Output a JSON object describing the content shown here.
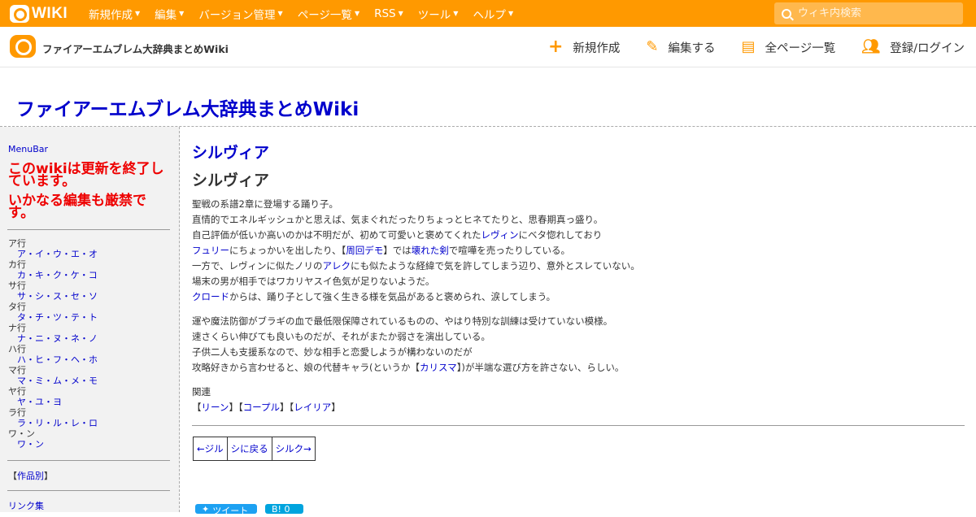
{
  "topbar": {
    "logo_text": "WIKI",
    "menu": [
      {
        "label": "新規作成"
      },
      {
        "label": "編集"
      },
      {
        "label": "バージョン管理"
      },
      {
        "label": "ページ一覧"
      },
      {
        "label": "RSS"
      },
      {
        "label": "ツール"
      },
      {
        "label": "ヘルプ"
      }
    ],
    "search_placeholder": "ウィキ内検索"
  },
  "header": {
    "site_name": "ファイアーエムブレム大辞典まとめWiki",
    "actions": [
      {
        "label": "新規作成",
        "icon": "plus-icon"
      },
      {
        "label": "編集する",
        "icon": "pencil-icon"
      },
      {
        "label": "全ページ一覧",
        "icon": "document-icon"
      },
      {
        "label": "登録/ログイン",
        "icon": "users-icon"
      }
    ]
  },
  "page_title": "ファイアーエムブレム大辞典まとめWiki",
  "sidebar": {
    "menubar_link": "MenuBar",
    "warning_1": "このwikiは更新を終了しています。",
    "warning_2": "いかなる編集も厳禁です。",
    "kana_groups": [
      {
        "group": "ア行",
        "link": "ア・イ・ウ・エ・オ"
      },
      {
        "group": "カ行",
        "link": "カ・キ・ク・ケ・コ"
      },
      {
        "group": "サ行",
        "link": "サ・シ・ス・セ・ソ"
      },
      {
        "group": "タ行",
        "link": "タ・チ・ツ・テ・ト"
      },
      {
        "group": "ナ行",
        "link": "ナ・ニ・ヌ・ネ・ノ"
      },
      {
        "group": "ハ行",
        "link": "ハ・ヒ・フ・ヘ・ホ"
      },
      {
        "group": "マ行",
        "link": "マ・ミ・ム・メ・モ"
      },
      {
        "group": "ヤ行",
        "link": "ヤ・ユ・ヨ"
      },
      {
        "group": "ラ行",
        "link": "ラ・リ・ル・レ・ロ"
      },
      {
        "group": "ワ・ン",
        "link": "ワ・ン"
      }
    ],
    "by_title_open": "【",
    "by_title_link": "作品別",
    "by_title_close": "】",
    "links_label": "リンク集"
  },
  "content": {
    "page_name": "シルヴィア",
    "heading": "シルヴィア",
    "para1": {
      "l1": "聖戦の系譜2章に登場する踊り子。",
      "l2": "直情的でエネルギッシュかと思えば、気まぐれだったりちょっとヒネてたりと、思春期真っ盛り。",
      "l3_a": "自己評価が低いか高いのかは不明だが、初めて可愛いと褒めてくれた",
      "l3_link": "レヴィン",
      "l3_b": "にベタ惚れしており",
      "l4_link1": "フュリー",
      "l4_a": "にちょっかいを出したり、【",
      "l4_link2": "周回デモ",
      "l4_b": "】では",
      "l4_link3": "壊れた剣",
      "l4_c": "で喧嘩を売ったりしている。",
      "l5_a": "一方で、レヴィンに似たノリの",
      "l5_link": "アレク",
      "l5_b": "にも似たような経緯で気を許してしまう辺り、意外とスレていない。",
      "l6": "場末の男が相手ではワカリヤスイ色気が足りないようだ。",
      "l7_link": "クロード",
      "l7_a": "からは、踊り子として強く生きる様を気品があると褒められ、涙してしまう。"
    },
    "para2": {
      "l1": "運や魔法防御がブラギの血で最低限保障されているものの、やはり特別な訓練は受けていない模様。",
      "l2": "速さくらい伸びても良いものだが、それがまたか弱さを演出している。",
      "l3": "子供二人も支援系なので、妙な相手と恋愛しようが構わないのだが",
      "l4_a": "攻略好きから言わせると、娘の代替キャラ(というか【",
      "l4_link": "カリスマ",
      "l4_b": "】)が半端な選び方を許さない、らしい。"
    },
    "related_label": "関連",
    "related": [
      {
        "open": "【",
        "label": "リーン",
        "close": "】"
      },
      {
        "open": "【",
        "label": "コープル",
        "close": "】"
      },
      {
        "open": "【",
        "label": "レイリア",
        "close": "】"
      }
    ],
    "nav": {
      "prev": "←ジル",
      "index": "シに戻る",
      "next": "シルク→"
    },
    "share": {
      "tweet": "ツイート",
      "hatena": "B! 0"
    }
  },
  "colors": {
    "brand_orange": "#ff9900",
    "link_blue": "#0000cc",
    "warning_red": "#ee0000"
  }
}
